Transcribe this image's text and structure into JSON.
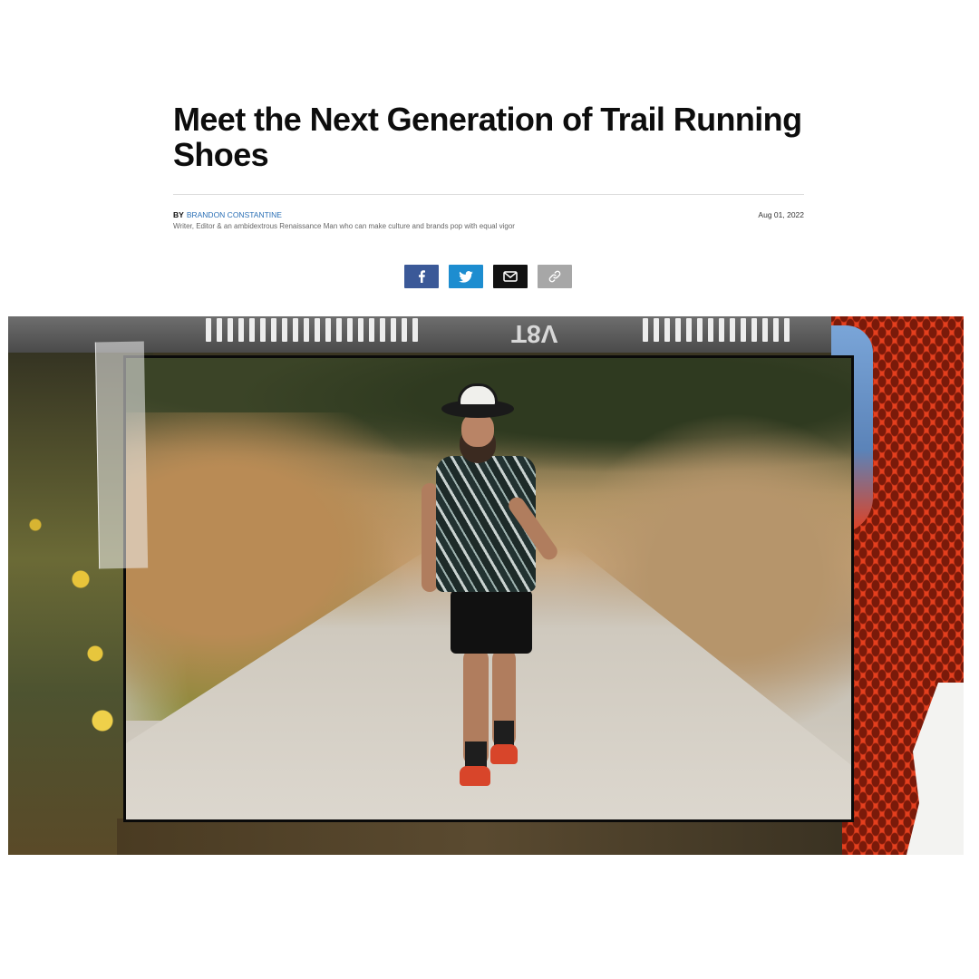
{
  "article": {
    "headline": "Meet the Next Generation of Trail Running Shoes",
    "byline_prefix": "BY",
    "author_name": "BRANDON CONSTANTINE",
    "author_bio": "Writer, Editor & an ambidextrous Renaissance Man who can make culture and brands pop with equal vigor",
    "date": "Aug 01, 2022"
  },
  "share": {
    "buttons": [
      {
        "icon": "facebook-icon",
        "color": "#3b5998"
      },
      {
        "icon": "twitter-icon",
        "color": "#1d8dd0"
      },
      {
        "icon": "mail-icon",
        "color": "#111111"
      },
      {
        "icon": "link-icon",
        "color": "#a7a7a7"
      }
    ]
  },
  "hero": {
    "top_strip_text": "V8T"
  }
}
